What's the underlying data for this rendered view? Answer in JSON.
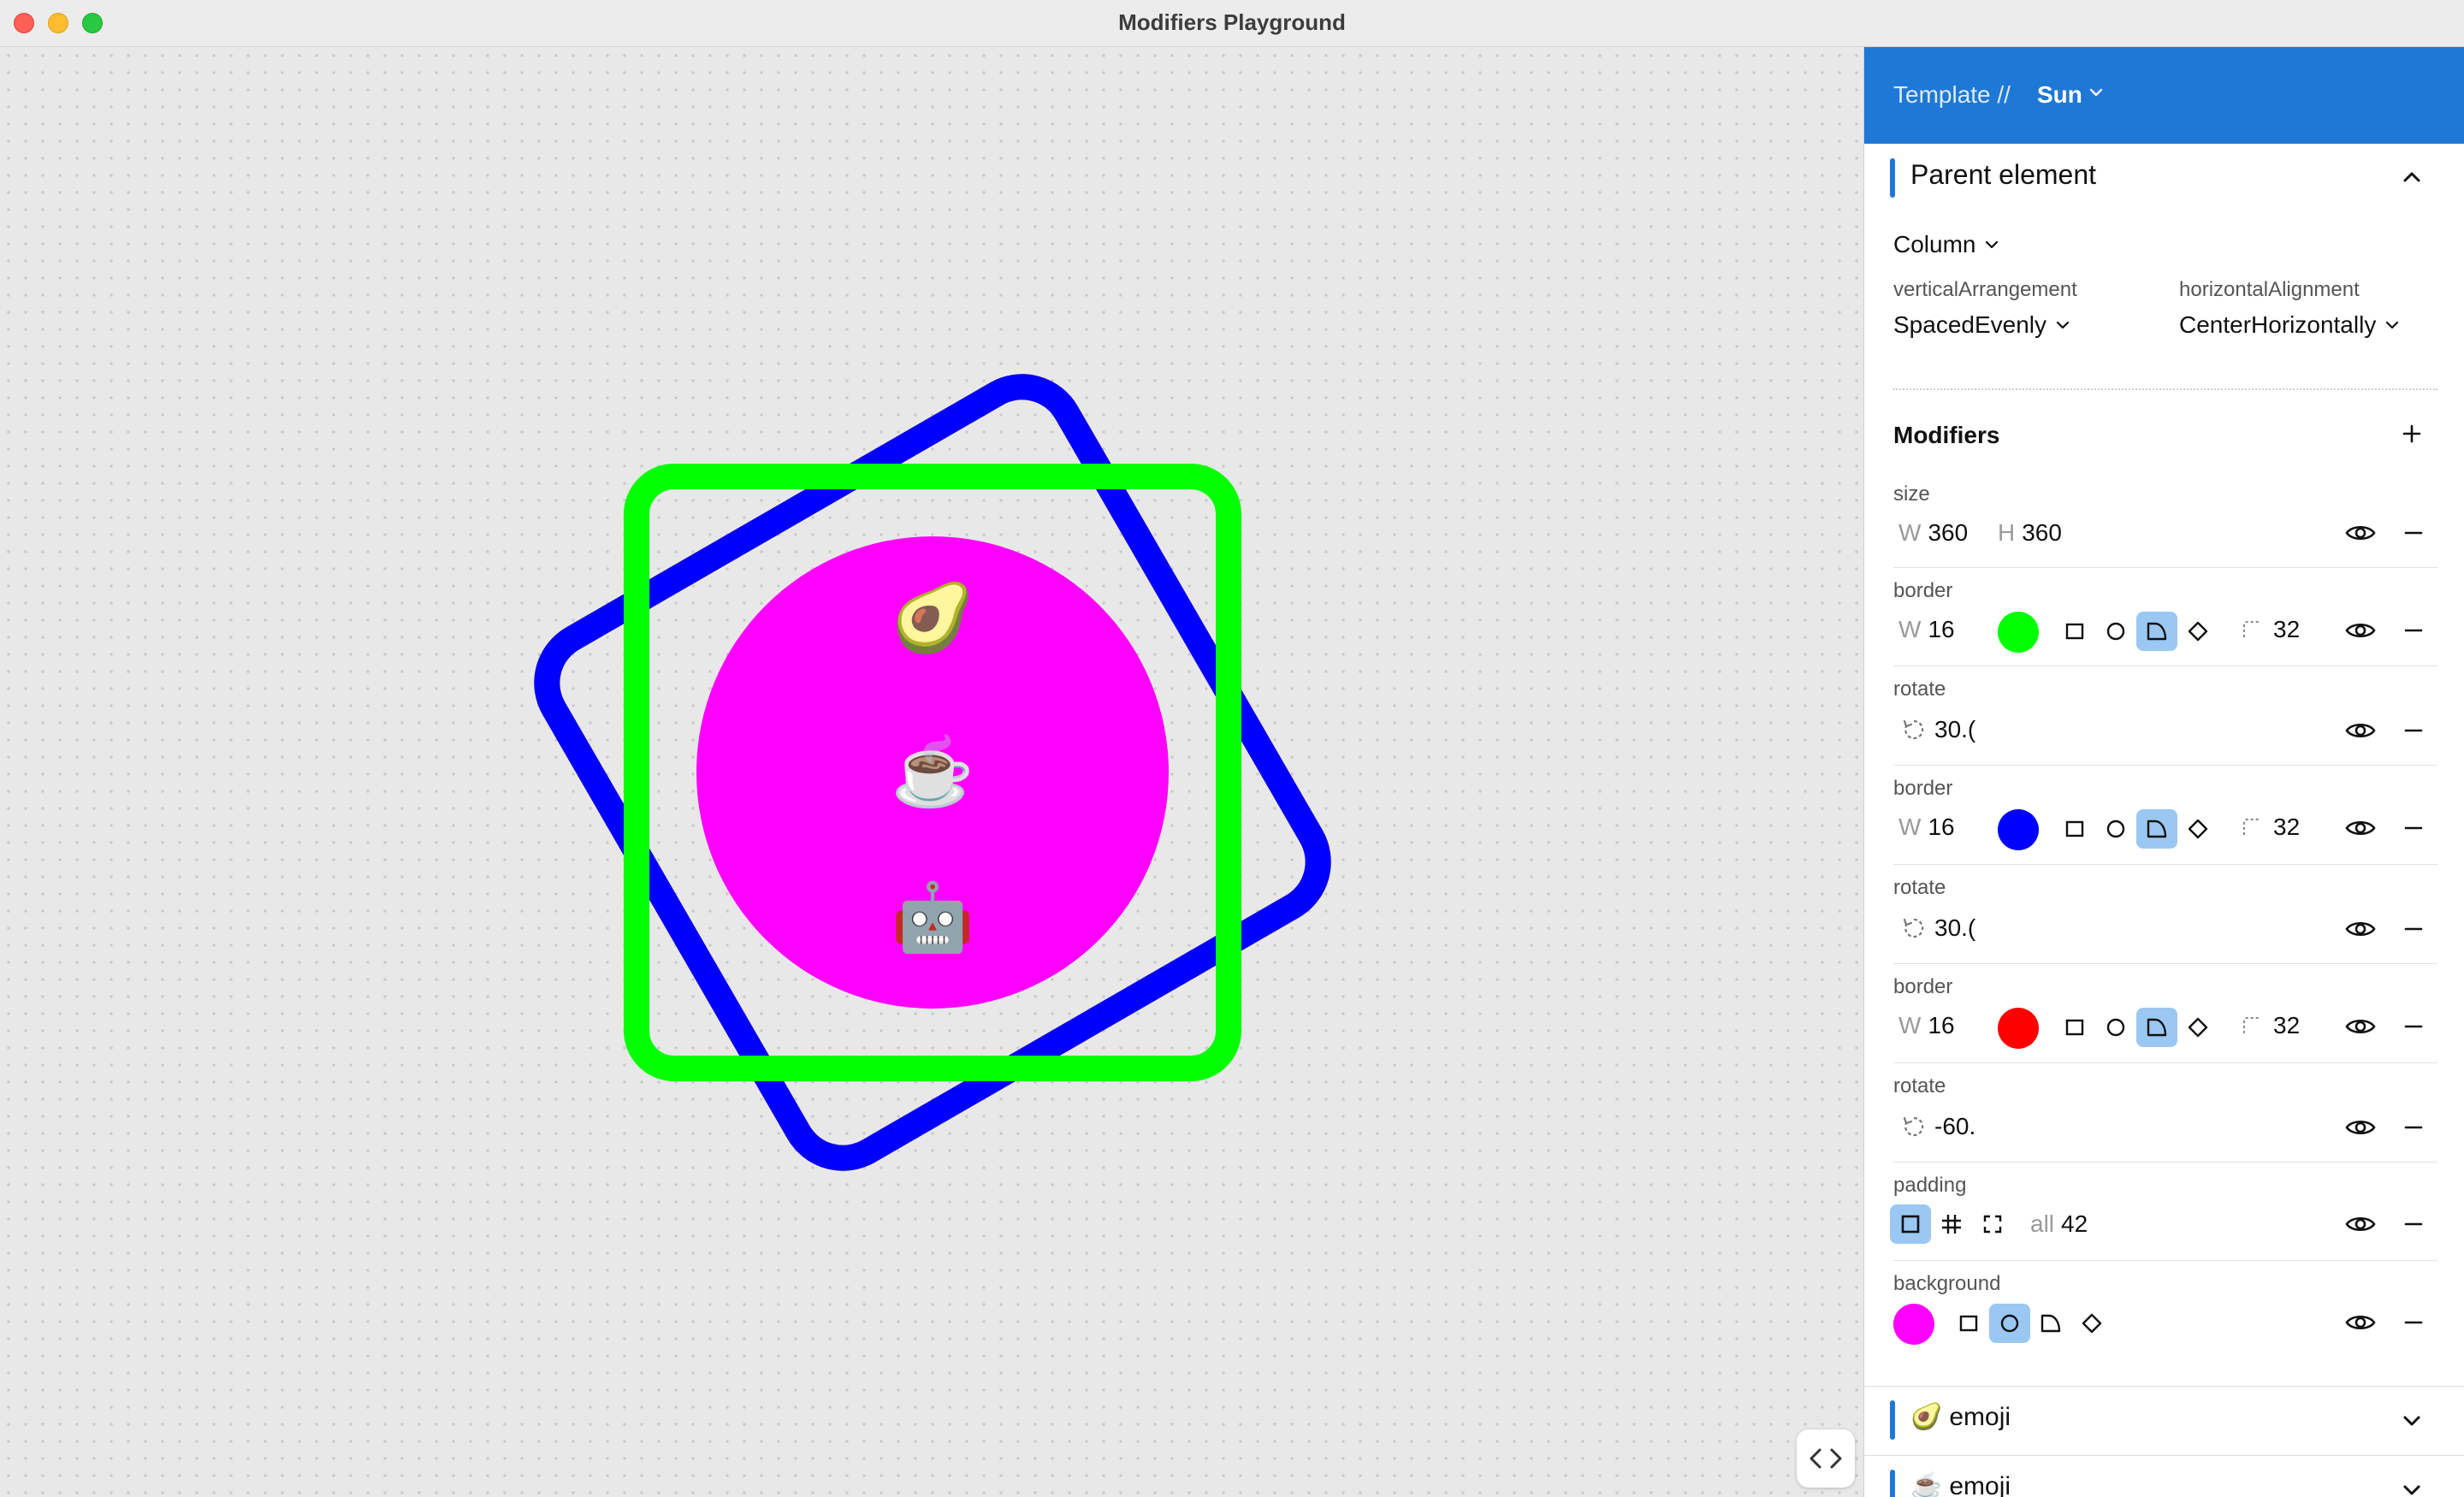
{
  "window": {
    "title": "Modifiers Playground"
  },
  "canvas": {
    "emojis": [
      "🥑",
      "☕",
      "🤖"
    ],
    "colors": {
      "green": "#00ff00",
      "blue": "#0000ff",
      "red": "#ff0000",
      "magenta": "#ff00ff"
    }
  },
  "header": {
    "prefix": "Template //",
    "template": "Sun"
  },
  "parent": {
    "title": "Parent element",
    "layout": "Column",
    "vertical_label": "verticalArrangement",
    "vertical_value": "SpacedEvenly",
    "horizontal_label": "horizontalAlignment",
    "horizontal_value": "CenterHorizontally"
  },
  "modifiers": {
    "title": "Modifiers",
    "size": {
      "label": "size",
      "w_prefix": "W",
      "w": "360",
      "h_prefix": "H",
      "h": "360"
    },
    "border1": {
      "label": "border",
      "w_prefix": "W",
      "w": "16",
      "color": "#00ff00",
      "radius": "32",
      "selected_shape": "rounded-corner"
    },
    "rotate1": {
      "label": "rotate",
      "value": "30.("
    },
    "border2": {
      "label": "border",
      "w_prefix": "W",
      "w": "16",
      "color": "#0000ff",
      "radius": "32",
      "selected_shape": "rounded-corner"
    },
    "rotate2": {
      "label": "rotate",
      "value": "30.("
    },
    "border3": {
      "label": "border",
      "w_prefix": "W",
      "w": "16",
      "color": "#ff0000",
      "radius": "32",
      "selected_shape": "rounded-corner"
    },
    "rotate3": {
      "label": "rotate",
      "value": "-60."
    },
    "padding": {
      "label": "padding",
      "mode_prefix": "all",
      "value": "42",
      "selected_mode": "all"
    },
    "background": {
      "label": "background",
      "color": "#ff00ff",
      "selected_shape": "circle"
    }
  },
  "children": [
    {
      "emoji": "🥑",
      "label": "emoji"
    },
    {
      "emoji": "☕",
      "label": "emoji"
    }
  ],
  "icons": [
    "chevron-up-icon",
    "chevron-down-icon",
    "plus-icon",
    "eye-icon",
    "minus-icon",
    "rotate-icon",
    "code-icon"
  ]
}
